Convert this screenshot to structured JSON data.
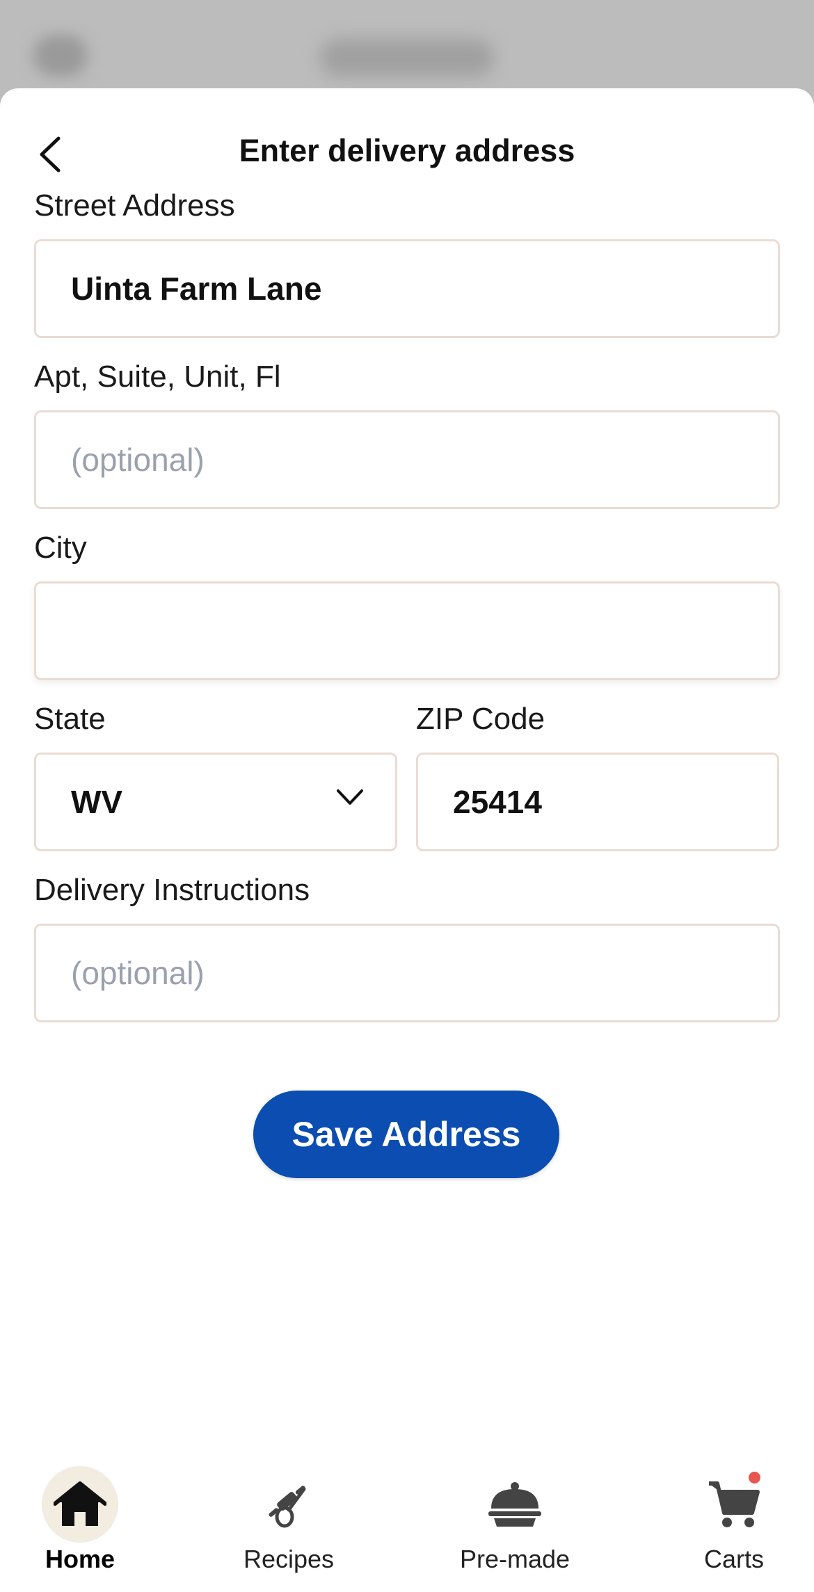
{
  "header": {
    "title": "Enter delivery address"
  },
  "form": {
    "street": {
      "label": "Street Address",
      "value": "Uinta Farm Lane"
    },
    "apt": {
      "label": "Apt, Suite, Unit, Fl",
      "placeholder": "(optional)"
    },
    "city": {
      "label": "City",
      "value": ""
    },
    "state": {
      "label": "State",
      "value": "WV"
    },
    "zip": {
      "label": "ZIP Code",
      "value": "25414"
    },
    "instructions": {
      "label": "Delivery Instructions",
      "placeholder": "(optional)"
    },
    "save_label": "Save Address"
  },
  "nav": {
    "items": [
      {
        "label": "Home",
        "icon": "home-icon",
        "active": true
      },
      {
        "label": "Recipes",
        "icon": "rolling-pin-whisk-icon",
        "active": false
      },
      {
        "label": "Pre-made",
        "icon": "cloche-icon",
        "active": false
      },
      {
        "label": "Carts",
        "icon": "cart-icon",
        "active": false
      }
    ]
  },
  "colors": {
    "primary": "#0b4db0",
    "field_border": "#eadcd3",
    "placeholder": "#9aa1ad",
    "active_nav_bg": "#f2ece1",
    "notification_dot": "#e8574f"
  }
}
